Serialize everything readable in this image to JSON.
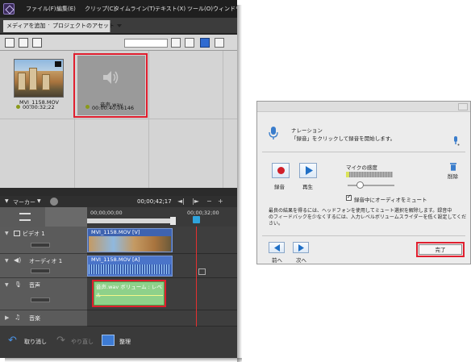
{
  "app": {
    "menu": [
      "ファイル(F)",
      "編集(E)",
      "クリップ(C)",
      "タイムライン(T)",
      "テキスト(X)",
      "ツール(O)",
      "ウィンドウ"
    ],
    "tabs": {
      "add_media": "メディアを追加",
      "project_assets": "プロジェクトのアセット"
    },
    "assets": [
      {
        "name": "MVI_1158.MOV",
        "duration": "00:00:32;22"
      },
      {
        "name": "音声.wav",
        "duration": "00:00:40;06146"
      }
    ],
    "timeline": {
      "marker_label": "マーカー",
      "timecode": "00;00;42;17",
      "ruler_start": "00;00;00;00",
      "ruler_mark": "00;00;32;00",
      "tracks": [
        {
          "name": "ビデオ 1",
          "clip": "MVI_1158.MOV [V]"
        },
        {
          "name": "オーディオ 1",
          "clip": "MVI_1158.MOV [A]"
        },
        {
          "name": "音声",
          "clip": "音声.wav ボリューム : レベル"
        },
        {
          "name": "音楽",
          "clip": ""
        }
      ]
    },
    "bottom": {
      "undo": "取り消し",
      "redo": "やり直し",
      "organize": "整理"
    }
  },
  "dialog": {
    "title": "ナレーション",
    "instruction": "「録音」をクリックして録音を開始します。",
    "mic_sensitivity_label": "マイクの感度",
    "record_label": "録音",
    "play_label": "再生",
    "delete_label": "削除",
    "mute_checkbox_label": "録音中にオーディオをミュート",
    "mute_checked": true,
    "tip_line1": "最良の結果を得るには、ヘッドフォンを使用してミュート選択を解除します。録音中",
    "tip_line2": "のフィードバックを少なくするには、入力レベルボリュームスライダーを低く設定してくだ",
    "tip_line3": "さい。",
    "prev_label": "前へ",
    "next_label": "次へ",
    "done_label": "完了",
    "colors": {
      "record_red": "#d0202a",
      "accent_blue": "#1f6fc6",
      "highlight_red": "#e01e2e"
    }
  }
}
